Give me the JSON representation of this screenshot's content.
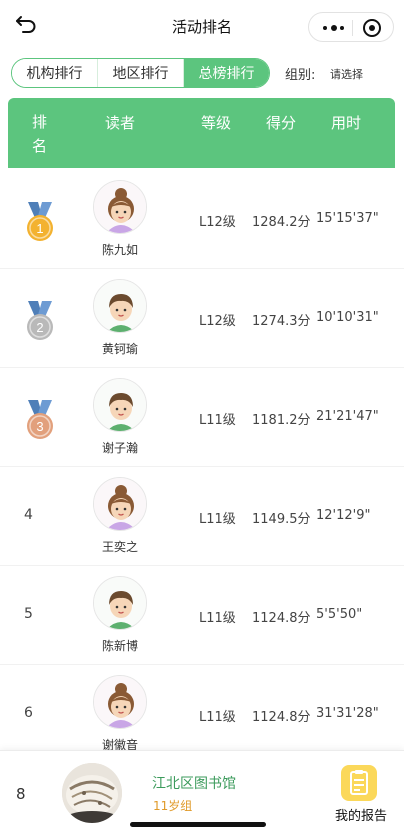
{
  "header": {
    "title": "活动排名"
  },
  "tabs": [
    {
      "label": "机构排行",
      "active": false
    },
    {
      "label": "地区排行",
      "active": false
    },
    {
      "label": "总榜排行",
      "active": true
    }
  ],
  "filter": {
    "label": "组别:",
    "placeholder": "请选择"
  },
  "table": {
    "columns": [
      "排名",
      "读者",
      "等级",
      "得分",
      "用时"
    ],
    "rows": [
      {
        "rank": "1",
        "medal": "gold",
        "avatar": "girl",
        "name": "陈九如",
        "level": "L12级",
        "score": "1284.2分",
        "time": "15'15'37\""
      },
      {
        "rank": "2",
        "medal": "silver",
        "avatar": "boy",
        "name": "黄钶瑜",
        "level": "L12级",
        "score": "1274.3分",
        "time": "10'10'31\""
      },
      {
        "rank": "3",
        "medal": "bronze",
        "avatar": "boy",
        "name": "谢子瀚",
        "level": "L11级",
        "score": "1181.2分",
        "time": "21'21'47\""
      },
      {
        "rank": "4",
        "medal": "",
        "avatar": "girl",
        "name": "王奕之",
        "level": "L11级",
        "score": "1149.5分",
        "time": "12'12'9\""
      },
      {
        "rank": "5",
        "medal": "",
        "avatar": "boy",
        "name": "陈新博",
        "level": "L11级",
        "score": "1124.8分",
        "time": "5'5'50\""
      },
      {
        "rank": "6",
        "medal": "",
        "avatar": "girl",
        "name": "谢徽音",
        "level": "L11级",
        "score": "1124.8分",
        "time": "31'31'28\""
      }
    ]
  },
  "my_entry": {
    "rank": "8",
    "org": "江北区图书馆",
    "group": "11岁组"
  },
  "report": {
    "label": "我的报告"
  },
  "colors": {
    "accent": "#5cc57e",
    "gold": "#f3b230",
    "silver": "#b9b9b9",
    "bronze": "#e2a07c"
  }
}
